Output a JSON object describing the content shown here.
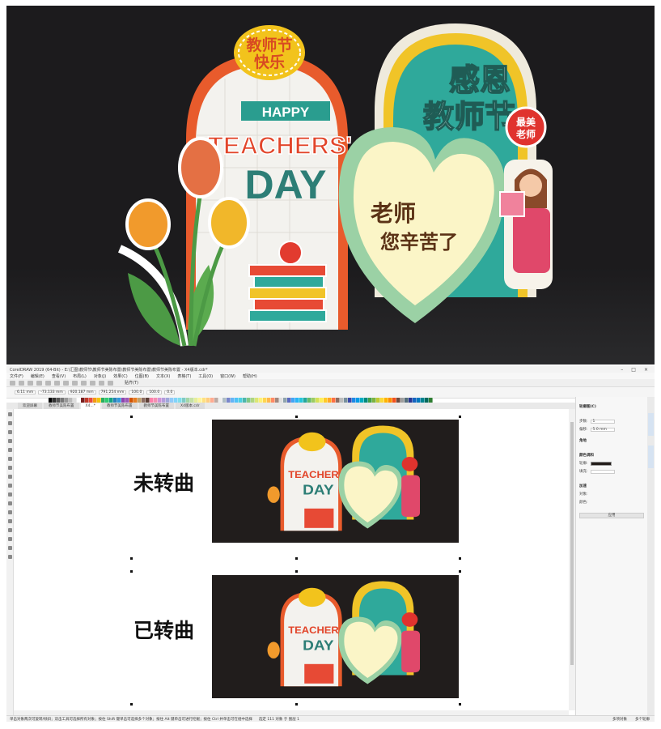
{
  "hero": {
    "badge_top": "教师节",
    "badge_bottom": "快乐",
    "happy": "HAPPY",
    "teachers": "TEACHERS'",
    "day": "DAY",
    "ganen_1": "感恩",
    "ganen_2": "教师节",
    "tag_1": "最美",
    "tag_2": "老师",
    "heart_line1": "老师",
    "heart_line2": "您辛苦了"
  },
  "app": {
    "title": "CorelDRAW 2019 (64-Bit) - E:\\汇图\\教师节\\教师节美陈布置\\教师节美陈布置\\教师节美陈布置 - X4版本.cdr*",
    "menu": [
      "文件(F)",
      "编辑(E)",
      "查看(V)",
      "布局(L)",
      "对象(J)",
      "效果(C)",
      "位图(B)",
      "文本(X)",
      "表格(T)",
      "工具(O)",
      "窗口(W)",
      "帮助(H)"
    ],
    "snap_label": "贴齐(T)",
    "prop": {
      "x": "6.11 mm",
      "y": "-73.133 mm",
      "w": "920.187 mm",
      "h": "791.254 mm",
      "sx": "100.0",
      "sy": "100.0",
      "angle": "0.0"
    },
    "tabs": [
      "欢迎屏幕",
      "教师节美陈布置",
      "X4...*",
      "教师节美陈布置",
      "教师节美陈布置",
      "X4版本.cdr"
    ],
    "labels": {
      "not_curved": "未转曲",
      "curved": "已转曲"
    },
    "docker": {
      "title": "轮廓图(C)",
      "steps_label": "步数:",
      "steps_value": "1",
      "offset_label": "偏移:",
      "offset_value": "5.0 mm",
      "corner": "角地",
      "color_section": "颜色调和",
      "outline_label": "轮廓:",
      "fill_label": "填充:",
      "accel": "加速",
      "object_label": "对象:",
      "color_label": "颜色:",
      "apply": "应用"
    },
    "status": {
      "left": "单击对象两次可旋转/倾斜；双击工具可选择所有对象；按住 Shift 键单击可选择多个对象；按住 Alt 键单击可进行挖掘；按住 Ctrl 并单击可在组中选择",
      "middle": "选定 111 对象 于 图层 1",
      "right_1": "多项对象",
      "right_2": "多个轮廓"
    }
  }
}
